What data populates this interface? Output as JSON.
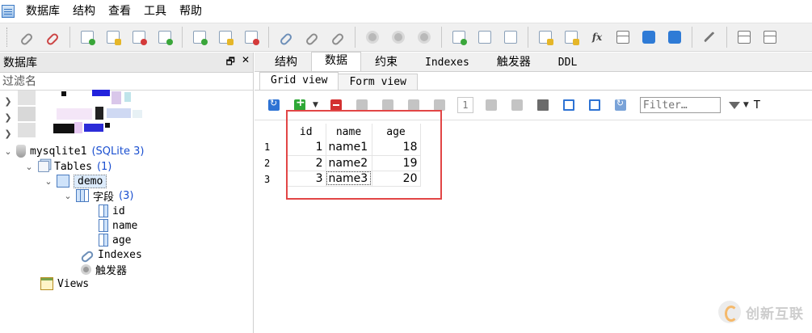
{
  "menu": {
    "items": [
      "数据库",
      "结构",
      "查看",
      "工具",
      "帮助"
    ]
  },
  "left_panel": {
    "title": "数据库",
    "pin_glyph": "🗗",
    "close_glyph": "✕",
    "filter_placeholder": "过滤名",
    "tree": {
      "db_name": "mysqlite1",
      "db_type": "(SQLite 3)",
      "tables_label": "Tables",
      "tables_count": "(1)",
      "table_name": "demo",
      "fields_label": "字段",
      "fields_count": "(3)",
      "fields": [
        "id",
        "name",
        "age"
      ],
      "indexes_label": "Indexes",
      "triggers_label": "触发器",
      "views_label": "Views"
    }
  },
  "right_panel": {
    "tabs": [
      {
        "label": "结构",
        "active": false
      },
      {
        "label": "数据",
        "active": true
      },
      {
        "label": "约束",
        "active": false
      },
      {
        "label": "Indexes",
        "active": false
      },
      {
        "label": "触发器",
        "active": false
      },
      {
        "label": "DDL",
        "active": false
      }
    ],
    "subtabs": [
      {
        "label": "Grid view",
        "active": true
      },
      {
        "label": "Form view",
        "active": false
      }
    ],
    "page_number": "1",
    "filter_placeholder": "Filter…",
    "trailing_letter": "T"
  },
  "grid": {
    "columns": [
      "id",
      "name",
      "age"
    ],
    "rows": [
      {
        "num": "1",
        "id": "1",
        "name": "name1",
        "age": "18"
      },
      {
        "num": "2",
        "id": "2",
        "name": "name2",
        "age": "19"
      },
      {
        "num": "3",
        "id": "3",
        "name": "name3",
        "age": "20"
      }
    ],
    "highlight_color": "#e24646"
  },
  "watermark": {
    "text": "创新互联"
  },
  "colors": {
    "count_blue": "#1a4fd0",
    "selection_bg": "#dcebfc"
  }
}
